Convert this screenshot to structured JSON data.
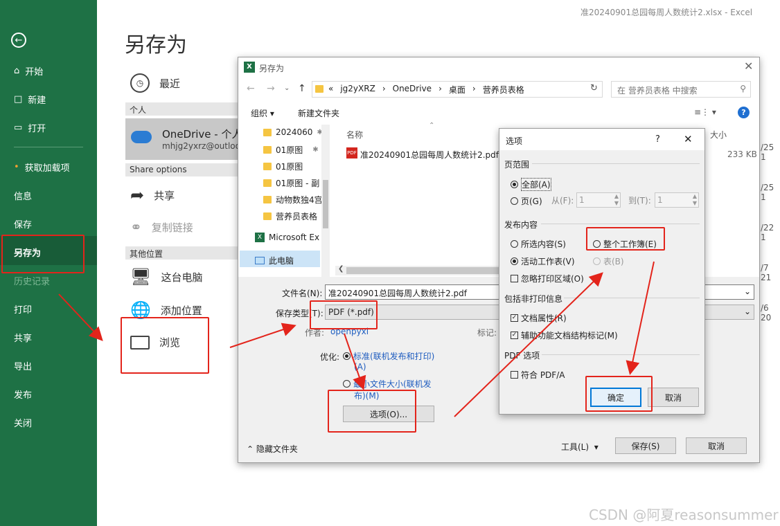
{
  "window_title": "准20240901总园每周人数统计2.xlsx - Excel",
  "sidebar": {
    "back_icon": "arrow-left-icon",
    "items": [
      {
        "label": "开始",
        "icon": "home-icon"
      },
      {
        "label": "新建",
        "icon": "new-doc-icon"
      },
      {
        "label": "打开",
        "icon": "folder-open-icon"
      },
      {
        "label": "获取加载项"
      },
      {
        "label": "信息"
      },
      {
        "label": "保存"
      },
      {
        "label": "另存为"
      },
      {
        "label": "历史记录"
      },
      {
        "label": "打印"
      },
      {
        "label": "共享"
      },
      {
        "label": "导出"
      },
      {
        "label": "发布"
      },
      {
        "label": "关闭"
      }
    ]
  },
  "saveas": {
    "title": "另存为",
    "recent": "最近",
    "personal_header": "个人",
    "onedrive_name": "OneDrive - 个人",
    "onedrive_email": "mhjg2yxrz@outloo",
    "share_header": "Share options",
    "share": "共享",
    "copy_link": "复制链接",
    "other_header": "其他位置",
    "this_pc": "这台电脑",
    "add_place": "添加位置",
    "browse": "浏览"
  },
  "file_dialog": {
    "title": "另存为",
    "breadcrumb": [
      "«",
      "jg2yXRZ",
      "OneDrive",
      "桌面",
      "营养员表格"
    ],
    "search_placeholder": "在 营养员表格 中搜索",
    "organize": "组织",
    "new_folder": "新建文件夹",
    "tree": [
      "2024060",
      "01原图",
      "01原图",
      "01原图 - 副",
      "动物数独4宫",
      "营养员表格",
      "Microsoft Ex",
      "此电脑"
    ],
    "col_name": "名称",
    "col_size": "大小",
    "file_name": "准20240901总园每周人数统计2.pdf",
    "file_size": "233 KB",
    "dates": [
      "/25 1",
      "/25 1",
      "/22 1",
      "/7 21",
      "/6 20"
    ],
    "filename_label": "文件名(N):",
    "filename_value": "准20240901总园每周人数统计2.pdf",
    "type_label": "保存类型(T):",
    "type_value": "PDF (*.pdf)",
    "author_label": "作者:",
    "author_value": "openpyxl",
    "tags_label": "标记:",
    "optimize_label": "优化:",
    "opt_standard": "标准(联机发布和打印)",
    "opt_standard_a": "(A)",
    "opt_min": "最小文件大小(联机发",
    "opt_min2": "布)(M)",
    "options_button": "选项(O)...",
    "hide_folders": "隐藏文件夹",
    "tools": "工具(L)",
    "save": "保存(S)",
    "cancel": "取消"
  },
  "options_dialog": {
    "title": "选项",
    "help": "?",
    "page_range": "页范围",
    "all": "全部(A)",
    "pages": "页(G)",
    "from": "从(F):",
    "from_val": "1",
    "to": "到(T):",
    "to_val": "1",
    "publish_what": "发布内容",
    "selection": "所选内容(S)",
    "whole_workbook": "整个工作簿(E)",
    "active_sheet": "活动工作表(V)",
    "table": "表(B)",
    "ignore_print_area": "忽略打印区域(O)",
    "non_print": "包括非打印信息",
    "doc_props": "文档属性(R)",
    "accessibility": "辅助功能文档结构标记(M)",
    "pdf_options": "PDF 选项",
    "pdfa": "符合 PDF/A",
    "ok": "确定",
    "cancel": "取消"
  },
  "watermark": "CSDN @阿夏reasonsummer"
}
